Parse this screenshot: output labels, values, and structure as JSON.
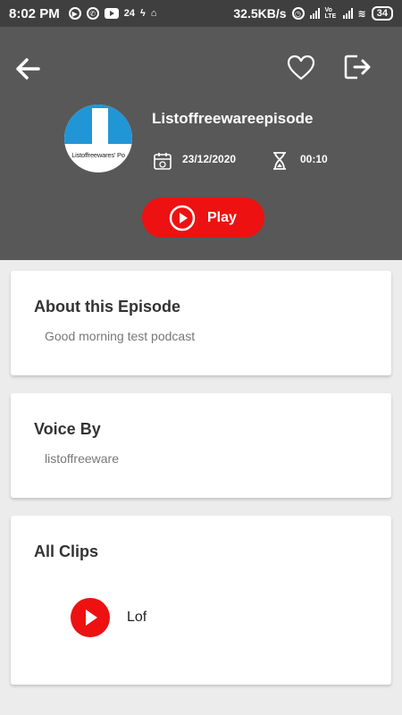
{
  "status_bar": {
    "time": "8:02 PM",
    "notif_count": "24",
    "speed": "32.5KB/s",
    "volte": "Vo LTE",
    "battery": "34"
  },
  "header": {
    "episode_title": "Listoffreewareepisode",
    "avatar_text": "Listoffreewares' Po",
    "date": "23/12/2020",
    "duration": "00:10",
    "play_label": "Play",
    "icons": [
      "back-arrow-icon",
      "heart-icon",
      "share-icon",
      "calendar-icon",
      "hourglass-icon",
      "play-circle-icon"
    ],
    "colors": {
      "header_bg": "#585858",
      "accent": "#ee1111",
      "avatar_blue": "#2196d6"
    }
  },
  "about": {
    "title": "About this Episode",
    "text": "Good morning test podcast"
  },
  "voice": {
    "title": "Voice By",
    "text": "listoffreeware"
  },
  "clips": {
    "title": "All Clips",
    "items": [
      {
        "name": "Lof"
      }
    ]
  }
}
